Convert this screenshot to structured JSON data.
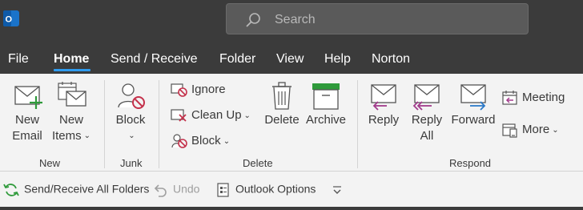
{
  "search": {
    "placeholder": "Search"
  },
  "tabs": [
    "File",
    "Home",
    "Send / Receive",
    "Folder",
    "View",
    "Help",
    "Norton"
  ],
  "active_tab": "Home",
  "ribbon": {
    "new": {
      "new_email": [
        "New",
        "Email"
      ],
      "new_items": [
        "New",
        "Items"
      ],
      "group_label": "New"
    },
    "junk": {
      "block": "Block",
      "group_label": "Junk"
    },
    "delete": {
      "ignore": "Ignore",
      "clean_up": "Clean Up",
      "block": "Block",
      "delete": "Delete",
      "archive": "Archive",
      "group_label": "Delete"
    },
    "respond": {
      "reply": "Reply",
      "reply_all": [
        "Reply",
        "All"
      ],
      "forward": "Forward",
      "meeting": "Meeting",
      "more": "More",
      "group_label": "Respond"
    }
  },
  "quick_access": {
    "send_receive": "Send/Receive All Folders",
    "undo": "Undo",
    "options": "Outlook Options"
  },
  "colors": {
    "accent": "#2f9cf0",
    "background_dark": "#3b3b3b",
    "ribbon_bg": "#f3f3f3",
    "reply_purple": "#a23b8c",
    "forward_blue": "#2a78c8",
    "archive_green": "#2e9a3a",
    "block_red": "#c4314b"
  }
}
